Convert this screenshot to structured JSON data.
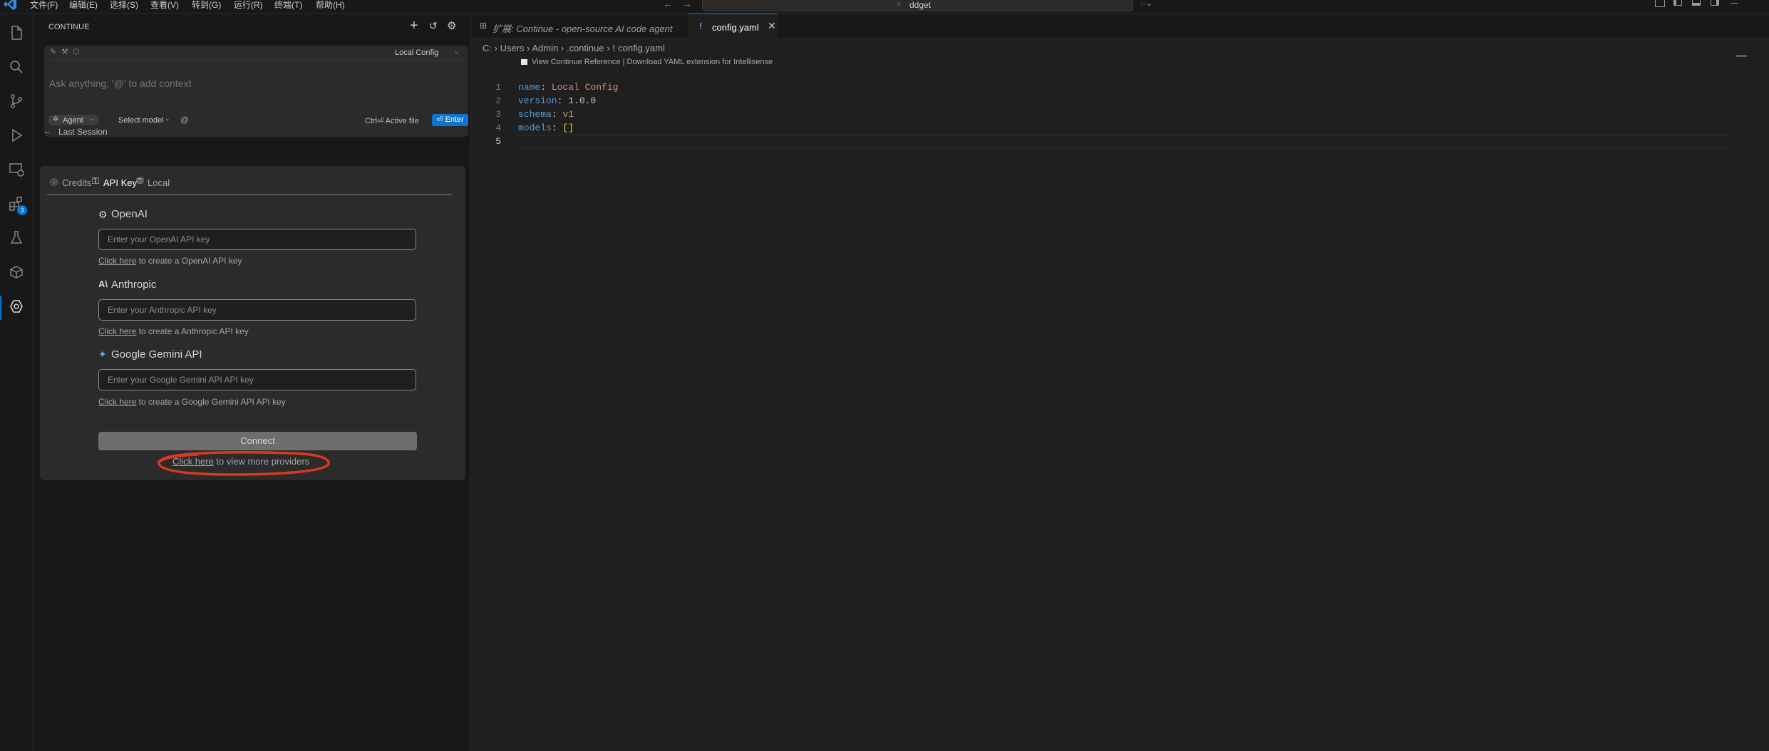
{
  "titlebar": {
    "menus": [
      "文件(F)",
      "编辑(E)",
      "选择(S)",
      "查看(V)",
      "转到(G)",
      "运行(R)",
      "终端(T)",
      "帮助(H)"
    ],
    "search_text": "ddget"
  },
  "activity": {
    "extensions_badge": "3"
  },
  "continue_panel": {
    "title": "CONTINUE",
    "config_selector": "Local Config",
    "input_placeholder": "Ask anything, '@' to add context",
    "mode_label": "Agent",
    "model_label": "Select model",
    "shortcut_hint": "Ctrl⏎ Active file",
    "enter_label": "⏎ Enter",
    "last_session": "Last Session",
    "tabs": [
      "Credits",
      "API Key",
      "Local"
    ],
    "providers": [
      {
        "name": "OpenAI",
        "placeholder": "Enter your OpenAI API key",
        "link": "Click here",
        "helper": " to create a OpenAI API key"
      },
      {
        "name": "Anthropic",
        "placeholder": "Enter your Anthropic API key",
        "link": "Click here",
        "helper": " to create a Anthropic API key"
      },
      {
        "name": "Google Gemini API",
        "placeholder": "Enter your Google Gemini API API key",
        "link": "Click here",
        "helper": " to create a Google Gemini API API key"
      }
    ],
    "connect_label": "Connect",
    "more_link": "Click here",
    "more_text": " to view more providers"
  },
  "editor": {
    "tabs": [
      {
        "label": "扩展: Continue - open-source AI code agent",
        "active": false
      },
      {
        "label": "config.yaml",
        "active": true
      }
    ],
    "breadcrumb": [
      "C:",
      "Users",
      "Admin",
      ".continue",
      "config.yaml"
    ],
    "codelens": "View Continue Reference | Download YAML extension for Intellisense",
    "lines": [
      {
        "num": "1",
        "key": "name",
        "value": "Local Config",
        "vtype": "v"
      },
      {
        "num": "2",
        "key": "version",
        "value": "1.0.0",
        "vtype": "n"
      },
      {
        "num": "3",
        "key": "schema",
        "value": "v1",
        "vtype": "v"
      },
      {
        "num": "4",
        "key": "models",
        "value": "[]",
        "vtype": "br"
      },
      {
        "num": "5",
        "key": "",
        "value": "",
        "vtype": ""
      }
    ]
  },
  "annotation": {
    "color": "#d93a1b"
  }
}
